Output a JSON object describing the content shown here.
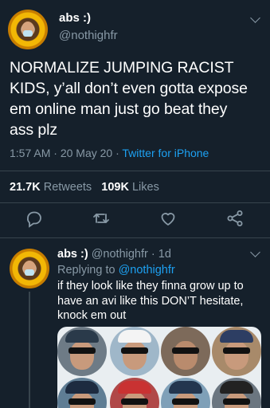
{
  "main_tweet": {
    "display_name": "abs :)",
    "handle": "@nothighfr",
    "text": "NORMALIZE JUMPING RACIST\nKIDS, y’all don’t even gotta expose\nem online man just go beat they\nass plz",
    "time": "1:57 AM",
    "date": "20 May 20",
    "source": "Twitter for iPhone",
    "separator": "·",
    "retweets_count": "21.7K",
    "retweets_label": "Retweets",
    "likes_count": "109K",
    "likes_label": "Likes"
  },
  "actions": {
    "icons": [
      "reply-icon",
      "retweet-icon",
      "like-icon",
      "share-icon"
    ]
  },
  "reply": {
    "display_name": "abs :)",
    "handle": "@nothighfr",
    "age": "1d",
    "replying_prefix": "Replying to",
    "replying_to": "@nothighfr",
    "text": "if they look like they finna grow up to\nhave an avi like this DON’T hesitate,\nknock em out"
  },
  "colors": {
    "background": "#15202b",
    "secondary_text": "#8899a6",
    "accent": "#1da1f2",
    "divider": "#38444d"
  }
}
